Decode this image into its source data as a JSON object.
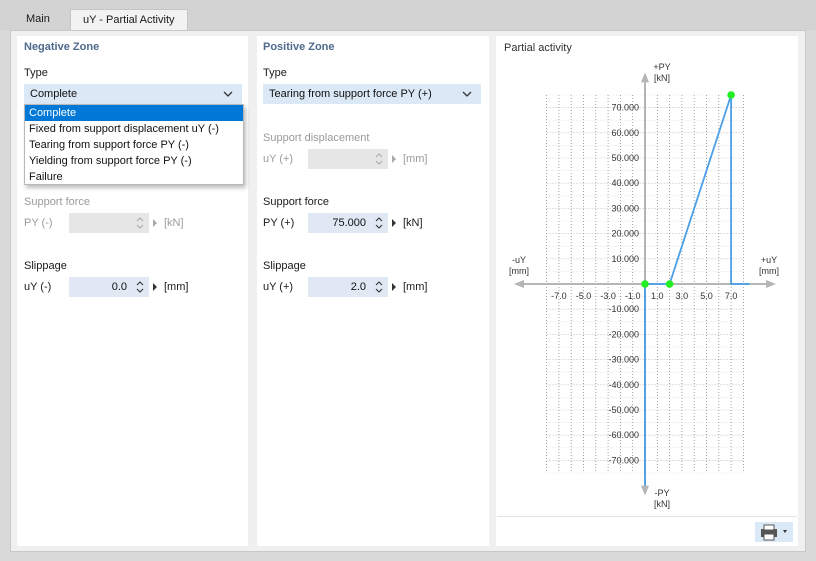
{
  "tabs": [
    {
      "label": "Main"
    },
    {
      "label": "uY - Partial Activity"
    }
  ],
  "negative": {
    "title": "Negative Zone",
    "type_label": "Type",
    "type_value": "Complete",
    "options": [
      "Complete",
      "Fixed from support displacement uY (-)",
      "Tearing from support force PY (-)",
      "Yielding from support force PY (-)",
      "Failure"
    ],
    "force_title": "Support force",
    "force_label": "PY (-)",
    "force_unit": "[kN]",
    "slip_title": "Slippage",
    "slip_label": "uY (-)",
    "slip_value": "0.0",
    "slip_unit": "[mm]"
  },
  "positive": {
    "title": "Positive Zone",
    "type_label": "Type",
    "type_value": "Tearing from support force PY (+)",
    "disp_title": "Support displacement",
    "disp_label": "uY (+)",
    "disp_unit": "[mm]",
    "force_title": "Support force",
    "force_label": "PY (+)",
    "force_value": "75.000",
    "force_unit": "[kN]",
    "slip_title": "Slippage",
    "slip_label": "uY (+)",
    "slip_value": "2.0",
    "slip_unit": "[mm]"
  },
  "chart": {
    "title": "Partial activity",
    "y_pos_label": "+PY",
    "y_pos_unit": "[kN]",
    "y_neg_label": "-PY",
    "y_neg_unit": "[kN]",
    "x_neg_label": "-uY",
    "x_neg_unit": "[mm]",
    "x_pos_label": "+uY",
    "x_pos_unit": "[mm]"
  },
  "chart_data": {
    "type": "line",
    "x_ticks": [
      "-7.0",
      "-5.0",
      "-3.0",
      "-1.0",
      "1.0",
      "3.0",
      "5.0",
      "7.0"
    ],
    "x_tick_values": [
      -7,
      -5,
      -3,
      -1,
      1,
      3,
      5,
      7
    ],
    "y_ticks": [
      "70.000",
      "60.000",
      "50.000",
      "40.000",
      "30.000",
      "20.000",
      "10.000",
      "-10.000",
      "-20.000",
      "-30.000",
      "-40.000",
      "-50.000",
      "-60.000",
      "-70.000"
    ],
    "y_tick_values": [
      70,
      60,
      50,
      40,
      30,
      20,
      10,
      -10,
      -20,
      -30,
      -40,
      -50,
      -60,
      -70
    ],
    "xlim": [
      -9,
      10
    ],
    "ylim": [
      -80,
      80
    ],
    "grid": true,
    "line_segments": [
      {
        "x": [
          0,
          0
        ],
        "y": [
          0,
          -80
        ]
      },
      {
        "x": [
          0,
          2,
          7,
          7,
          8.5
        ],
        "y": [
          0,
          0,
          75,
          0,
          0
        ]
      }
    ],
    "points": [
      {
        "x": 0,
        "y": 0
      },
      {
        "x": 2,
        "y": 0
      },
      {
        "x": 7,
        "y": 75
      }
    ],
    "line_color": "#4a9fe8",
    "point_color": "#22ee22"
  }
}
